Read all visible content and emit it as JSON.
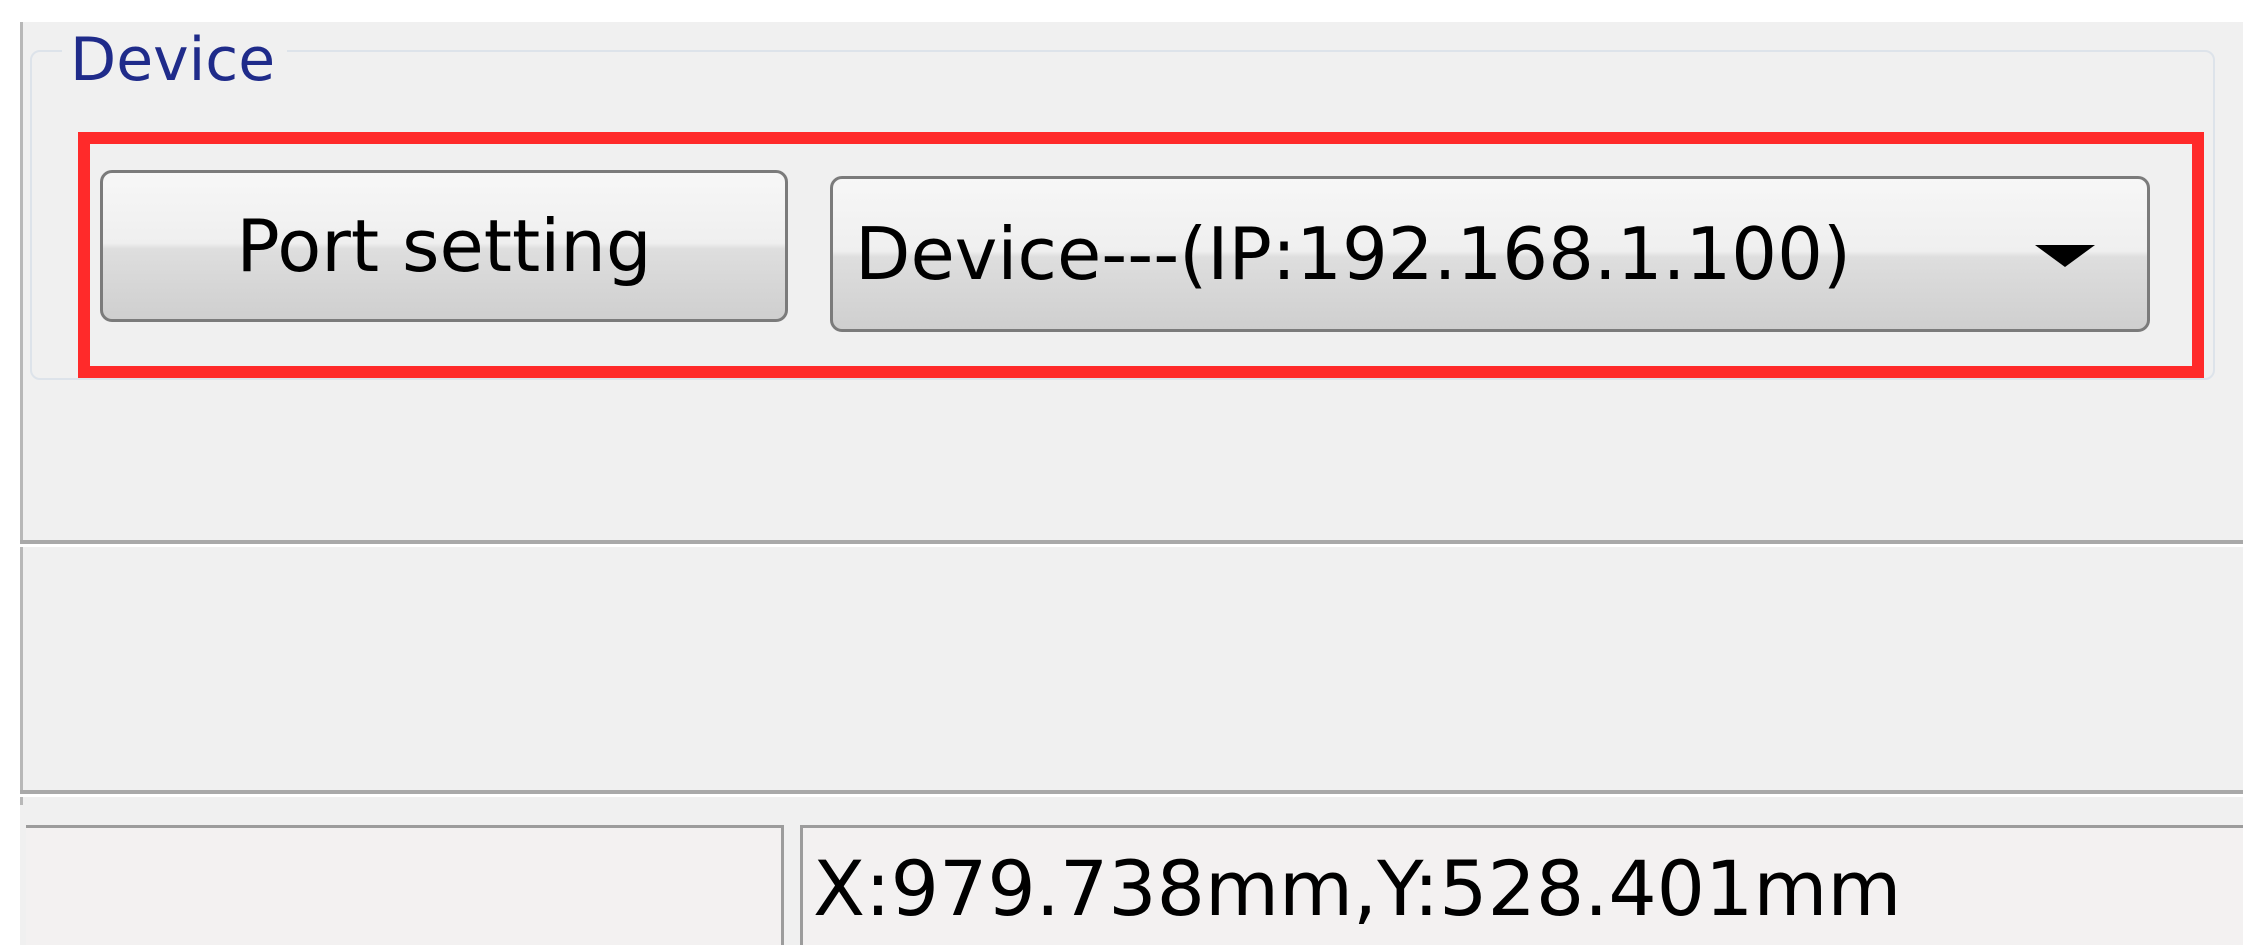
{
  "device_group": {
    "title": "Device",
    "port_setting_label": "Port setting",
    "device_select": {
      "selected": "Device---(IP:192.168.1.100)"
    }
  },
  "status_bar": {
    "coordinates": "X:979.738mm,Y:528.401mm"
  },
  "colors": {
    "highlight": "#ff2a2a",
    "panel_bg": "#f0f0f0",
    "group_title": "#1f2b8a"
  }
}
